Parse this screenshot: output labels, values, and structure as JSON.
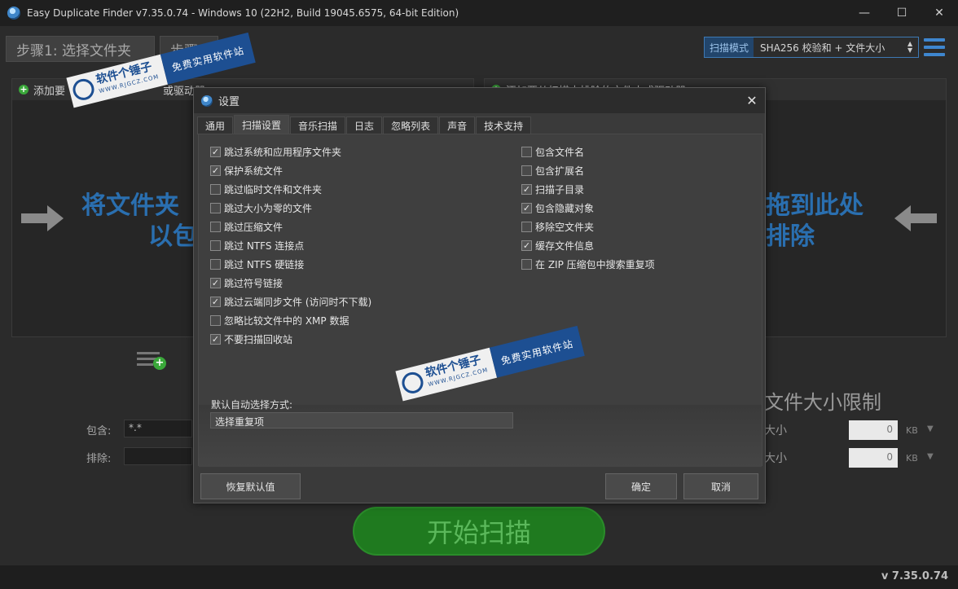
{
  "window": {
    "title": "Easy Duplicate Finder v7.35.0.74 - Windows 10 (22H2, Build 19045.6575, 64-bit Edition)",
    "minimize": "—",
    "maximize": "☐",
    "close": "✕"
  },
  "steps": {
    "step1": "步骤1: 选择文件夹",
    "step2": "步骤"
  },
  "scan_mode": {
    "label": "扫描模式",
    "value": "SHA256 校验和 + 文件大小"
  },
  "left_panel": {
    "header": "添加要",
    "header_tail": "或驱动器",
    "drop_line1": "将文件夹",
    "drop_line2": "以包"
  },
  "right_panel": {
    "header": "添加要从扫描中排除的文件夹或驱动器",
    "drop_line1": "拖到此处",
    "drop_line2": "排除"
  },
  "filters": {
    "include_label": "包含:",
    "include_value": "*.*",
    "exclude_label": "排除:",
    "exclude_value": ""
  },
  "size_limit": {
    "title": "文件大小限制",
    "min_label": "大小",
    "min_value": "0",
    "max_label": "大小",
    "max_value": "0",
    "unit": "KB"
  },
  "start_button": "开始扫描",
  "version": "v 7.35.0.74",
  "dialog": {
    "title": "设置",
    "close": "✕",
    "tabs": [
      "通用",
      "扫描设置",
      "音乐扫描",
      "日志",
      "忽略列表",
      "声音",
      "技术支持"
    ],
    "active_tab": 1,
    "left_options": [
      {
        "label": "跳过系统和应用程序文件夹",
        "checked": true
      },
      {
        "label": "保护系统文件",
        "checked": true
      },
      {
        "label": "跳过临时文件和文件夹",
        "checked": false
      },
      {
        "label": "跳过大小为零的文件",
        "checked": false
      },
      {
        "label": "跳过压缩文件",
        "checked": false
      },
      {
        "label": "跳过 NTFS 连接点",
        "checked": false
      },
      {
        "label": "跳过 NTFS 硬链接",
        "checked": false
      },
      {
        "label": "跳过符号链接",
        "checked": true
      },
      {
        "label": "跳过云端同步文件 (访问时不下载)",
        "checked": true
      },
      {
        "label": "忽略比较文件中的 XMP 数据",
        "checked": false
      },
      {
        "label": "不要扫描回收站",
        "checked": true
      }
    ],
    "right_options": [
      {
        "label": "包含文件名",
        "checked": false
      },
      {
        "label": "包含扩展名",
        "checked": false
      },
      {
        "label": "扫描子目录",
        "checked": true
      },
      {
        "label": "包含隐藏对象",
        "checked": true
      },
      {
        "label": "移除空文件夹",
        "checked": false
      },
      {
        "label": "缓存文件信息",
        "checked": true
      },
      {
        "label": "在 ZIP 压缩包中搜索重复项",
        "checked": false
      }
    ],
    "auto_select_label": "默认自动选择方式:",
    "auto_select_value": "选择重复项",
    "restore_defaults": "恢复默认值",
    "ok": "确定",
    "cancel": "取消"
  },
  "watermark": {
    "main": "软件个锤子",
    "url": "WWW.RJGCZ.COM",
    "slogan": "免费实用软件站"
  },
  "colors": {
    "accent_blue": "#2a6fb0",
    "start_green": "#1f7a1f",
    "watermark_blue": "#1d4f92"
  }
}
